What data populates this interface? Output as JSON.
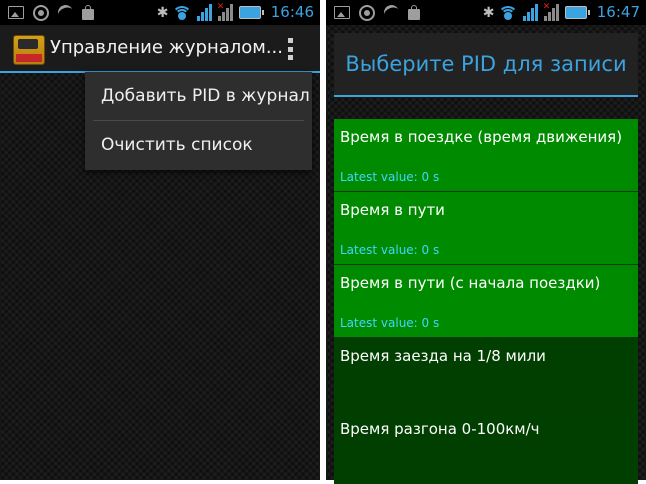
{
  "left": {
    "status": {
      "time": "16:46"
    },
    "app_title": "Управление журналом...",
    "menu": [
      {
        "label": "Добавить PID в журнал"
      },
      {
        "label": "Очистить список"
      }
    ]
  },
  "right": {
    "status": {
      "time": "16:47"
    },
    "dialog_title": "Выберите PID для записи",
    "pids": [
      {
        "name": "Время в поездке (время движения)",
        "latest": "Latest value: 0 s",
        "active": true
      },
      {
        "name": "Время в пути",
        "latest": "Latest value: 0 s",
        "active": true
      },
      {
        "name": "Время в пути (с начала поездки)",
        "latest": "Latest value: 0 s",
        "active": true
      },
      {
        "name": "Время заезда на 1/8 мили",
        "latest": "",
        "active": false
      },
      {
        "name": "Время разгона 0-100км/ч",
        "latest": "",
        "active": false
      }
    ]
  },
  "colors": {
    "accent": "#3aa3e0",
    "pid_active": "#008a00",
    "pid_inactive": "#003f00",
    "latest": "#3fd7ff"
  }
}
